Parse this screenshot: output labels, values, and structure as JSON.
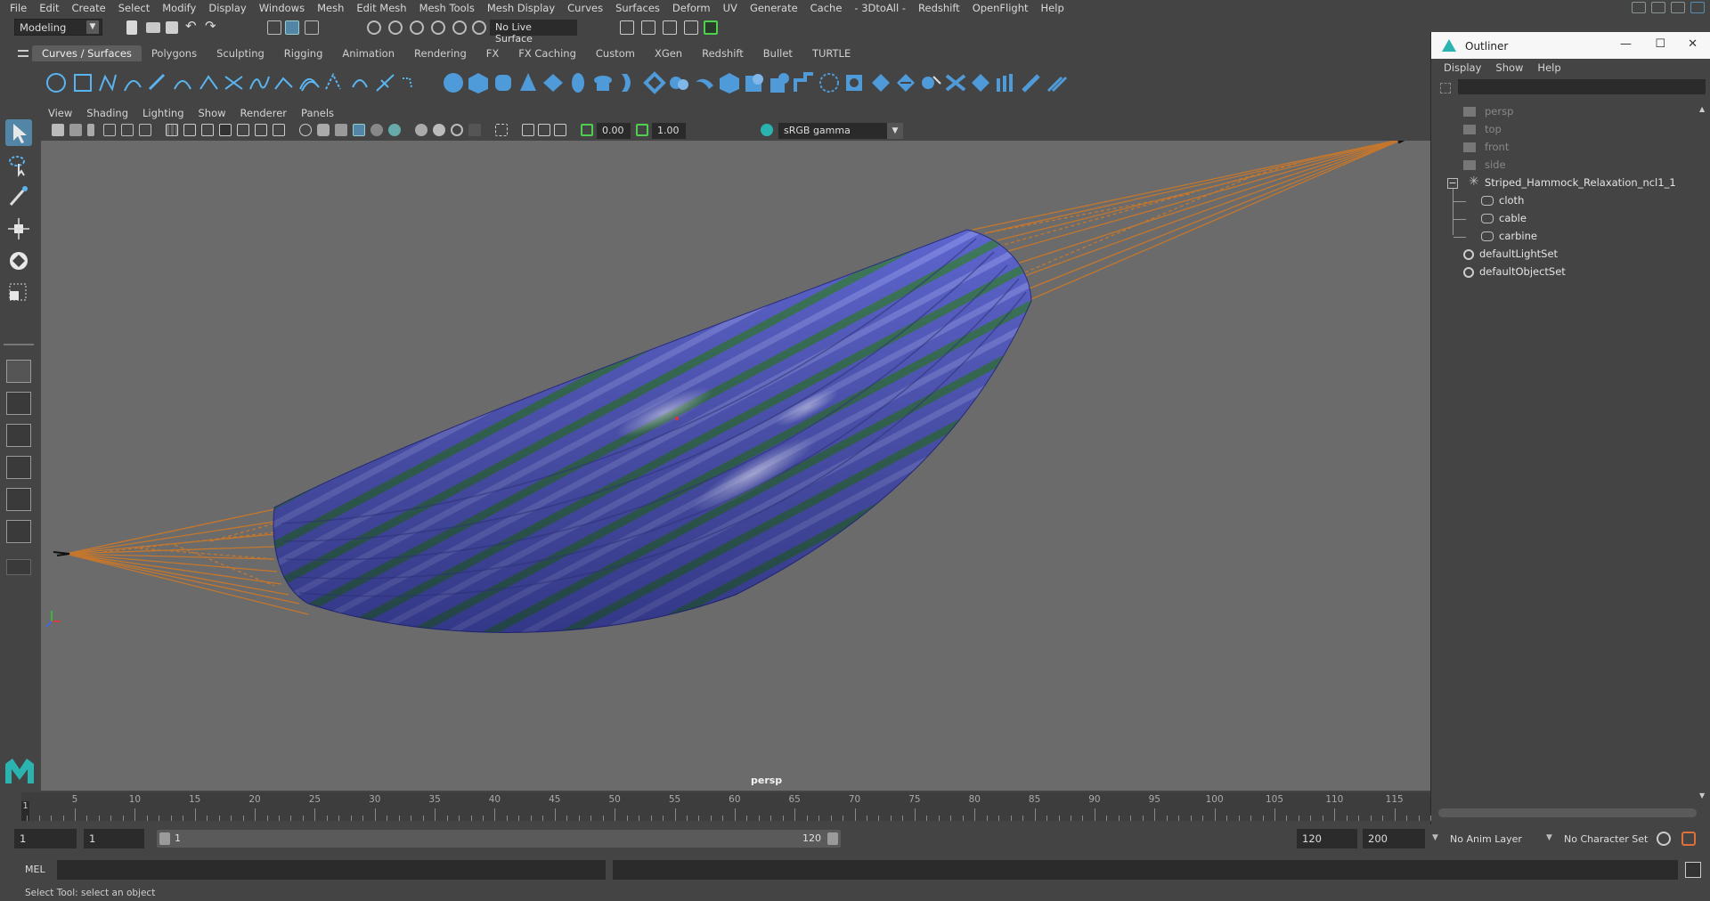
{
  "menubar": {
    "items": [
      "File",
      "Edit",
      "Create",
      "Select",
      "Modify",
      "Display",
      "Windows",
      "Mesh",
      "Edit Mesh",
      "Mesh Tools",
      "Mesh Display",
      "Curves",
      "Surfaces",
      "Deform",
      "UV",
      "Generate",
      "Cache",
      "- 3DtoAll -",
      "Redshift",
      "OpenFlight",
      "Help"
    ]
  },
  "statusline": {
    "mode": "Modeling",
    "live_surface": "No Live Surface"
  },
  "shelf": {
    "tabs": [
      "Curves / Surfaces",
      "Polygons",
      "Sculpting",
      "Rigging",
      "Animation",
      "Rendering",
      "FX",
      "FX Caching",
      "Custom",
      "XGen",
      "Redshift",
      "Bullet",
      "TURTLE"
    ],
    "active_tab": "Curves / Surfaces"
  },
  "viewport": {
    "menu": [
      "View",
      "Shading",
      "Lighting",
      "Show",
      "Renderer",
      "Panels"
    ],
    "exposure": "0.00",
    "gamma_value": "1.00",
    "color_space": "sRGB gamma",
    "camera_label": "persp"
  },
  "outliner": {
    "title": "Outliner",
    "menu": [
      "Display",
      "Show",
      "Help"
    ],
    "items": [
      {
        "label": "persp",
        "icon": "camera-icon"
      },
      {
        "label": "top",
        "icon": "camera-icon"
      },
      {
        "label": "front",
        "icon": "camera-icon"
      },
      {
        "label": "side",
        "icon": "camera-icon"
      },
      {
        "label": "Striped_Hammock_Relaxation_ncl1_1",
        "icon": "group-icon"
      },
      {
        "label": "cloth",
        "icon": "mesh-icon"
      },
      {
        "label": "cable",
        "icon": "mesh-icon"
      },
      {
        "label": "carbine",
        "icon": "mesh-icon"
      },
      {
        "label": "defaultLightSet",
        "icon": "set-icon"
      },
      {
        "label": "defaultObjectSet",
        "icon": "set-icon"
      }
    ]
  },
  "timeline": {
    "ticks": [
      "5",
      "10",
      "15",
      "20",
      "25",
      "30",
      "35",
      "40",
      "45",
      "50",
      "55",
      "60",
      "65",
      "70",
      "75",
      "80",
      "85",
      "90",
      "95",
      "100",
      "105",
      "110",
      "115"
    ],
    "current_frame": "1"
  },
  "range": {
    "start": "1",
    "playback_start": "1",
    "range_start_label": "1",
    "range_end_label": "120",
    "playback_end": "120",
    "end": "200",
    "anim_layer": "No Anim Layer",
    "character_set": "No Character Set"
  },
  "cmdline": {
    "label": "MEL"
  },
  "helpline": {
    "text": "Select Tool: select an object"
  },
  "colors": {
    "accent": "#5285a6",
    "hammock_blue": "#5a63c9",
    "hammock_green": "#3d7a5a",
    "rope": "#c9782a",
    "viewport_bg": "#6b6b6b"
  }
}
